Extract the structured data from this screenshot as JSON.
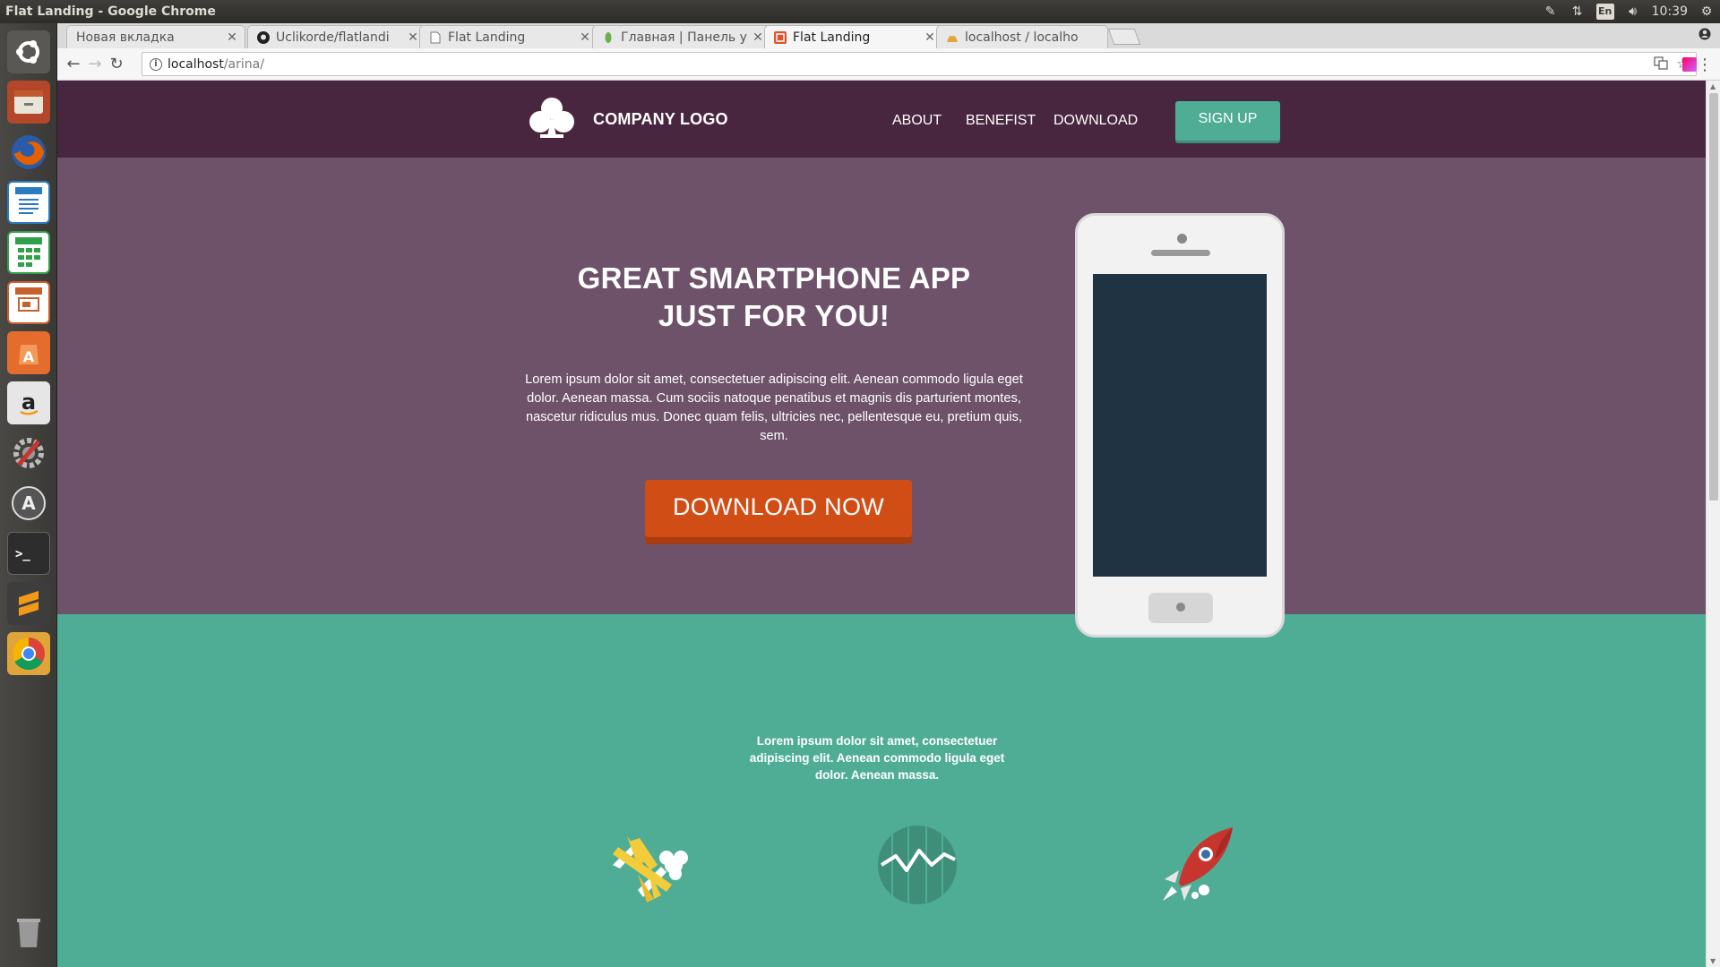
{
  "os": {
    "window_title": "Flat Landing - Google Chrome",
    "panel": {
      "lang": "En",
      "clock": "10:39"
    },
    "launcher_items": [
      {
        "name": "ubuntu-dash-icon",
        "color": "#555"
      },
      {
        "name": "files-icon",
        "color": "#c25a2f"
      },
      {
        "name": "firefox-icon",
        "color": "#e66000"
      },
      {
        "name": "libreoffice-writer-icon",
        "color": "#2b7bc0"
      },
      {
        "name": "libreoffice-calc-icon",
        "color": "#31a04a"
      },
      {
        "name": "libreoffice-impress-icon",
        "color": "#c8602c"
      },
      {
        "name": "software-center-icon",
        "color": "#e46c2d"
      },
      {
        "name": "amazon-icon",
        "color": "#e6e6e6"
      },
      {
        "name": "system-settings-icon",
        "color": "#777"
      },
      {
        "name": "software-updater-icon",
        "color": "#666"
      },
      {
        "name": "terminal-icon",
        "color": "#2d2d2d"
      },
      {
        "name": "sublime-text-icon",
        "color": "#3d3d3d"
      },
      {
        "name": "chrome-icon",
        "color": "#e6a23c"
      },
      {
        "name": "trash-icon",
        "color": "#777"
      }
    ]
  },
  "browser": {
    "tabs": [
      {
        "label": "Новая вкладка",
        "favicon": "none"
      },
      {
        "label": "Uclikorde/flatlandi",
        "favicon": "github-icon"
      },
      {
        "label": "Flat Landing",
        "favicon": "page-icon"
      },
      {
        "label": "Главная | Панель у",
        "favicon": "leaf-icon"
      },
      {
        "label": "Flat Landing",
        "favicon": "site-icon",
        "active": true
      },
      {
        "label": "localhost / localho",
        "favicon": "phpmyadmin-icon"
      }
    ],
    "address": {
      "host": "localhost",
      "path": "/arina/"
    }
  },
  "site": {
    "logo_text": "COMPANY LOGO",
    "nav": [
      "ABOUT",
      "BENEFIST",
      "DOWNLOAD"
    ],
    "signup_label": "SIGN UP",
    "hero": {
      "title_line1": "GREAT SMARTPHONE APP",
      "title_line2": "JUST FOR YOU!",
      "text": "Lorem ipsum dolor sit amet, consectetuer adipiscing elit. Aenean commodo ligula eget dolor. Aenean massa. Cum sociis natoque penatibus et magnis dis parturient montes, nascetur ridiculus mus. Donec quam felis, ultricies nec, pellentesque eu, pretium quis, sem.",
      "download_label": "DOWNLOAD NOW"
    },
    "features": {
      "intro": "Lorem ipsum dolor sit amet, consectetuer adipiscing elit. Aenean commodo ligula eget dolor. Aenean massa.",
      "icons": [
        "airplane-icon",
        "chart-icon",
        "rocket-icon"
      ]
    },
    "colors": {
      "header": "#48263f",
      "hero": "#6e526a",
      "teal": "#4fad96",
      "download": "#d14d16",
      "phone_screen": "#1f3342"
    }
  }
}
